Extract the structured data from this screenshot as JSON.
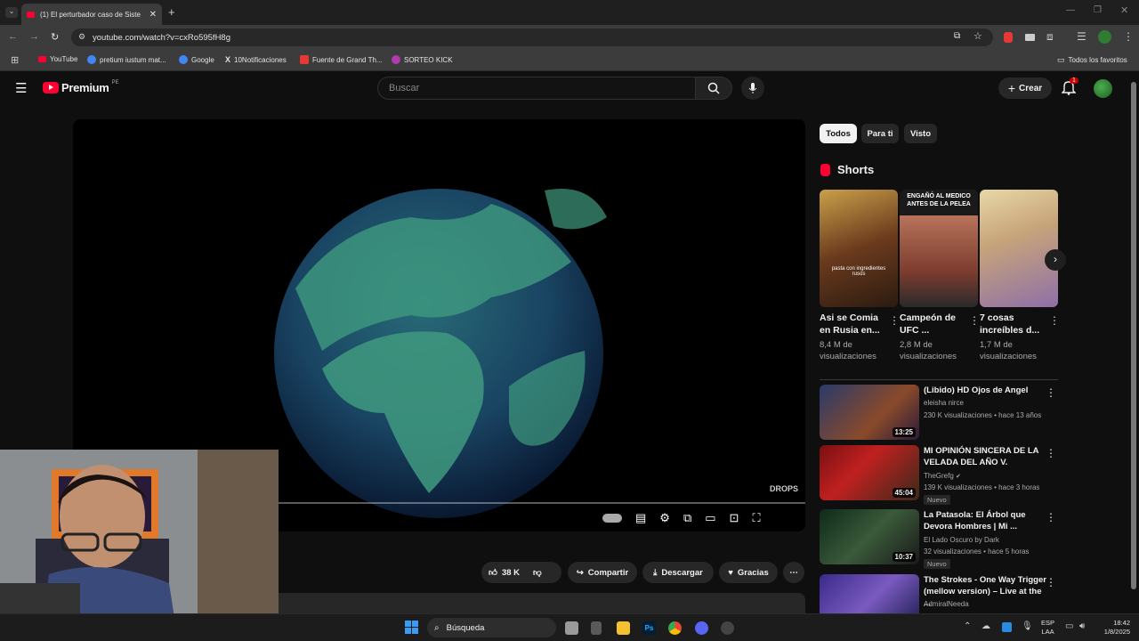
{
  "browser": {
    "tab_title": "(1) El perturbador caso de Siste",
    "url": "youtube.com/watch?v=cxRo595fH8g",
    "bookmarks": [
      "YouTube",
      "pretium iustum mat...",
      "Google",
      "10Notificaciones",
      "Fuente de Grand Th...",
      "SORTEO KICK"
    ],
    "all_bookmarks": "Todos los favoritos"
  },
  "youtube": {
    "logo_text": "Premium",
    "country": "PE",
    "search_placeholder": "Buscar",
    "create_label": "Crear",
    "notification_count": "1"
  },
  "chips": [
    "Todos",
    "Para ti",
    "Visto"
  ],
  "shorts_title": "Shorts",
  "shorts": [
    {
      "title": "Asi se Comia en Rusia en...",
      "views": "8,4 M de visualizaciones",
      "overlay": "pasta con ingredientes rusos"
    },
    {
      "title": "Campeón de UFC ...",
      "views": "2,8 M de visualizaciones",
      "overlay": "ENGAÑÓ AL MEDICO ANTES DE LA PELEA"
    },
    {
      "title": "7 cosas increíbles d...",
      "views": "1,7 M de visualizaciones",
      "overlay": ""
    }
  ],
  "recommendations": [
    {
      "title": "(Libido) HD Ojos de Angel",
      "channel": "eleisha nirce",
      "meta": "230 K visualizaciones • hace 13 años",
      "duration": "13:25",
      "badge": ""
    },
    {
      "title": "MI OPINIÓN SINCERA DE LA VELADA DEL AÑO V.",
      "channel": "TheGrefg",
      "meta": "139 K visualizaciones • hace 3 horas",
      "duration": "45:04",
      "badge": "Nuevo"
    },
    {
      "title": "La Patasola: El Árbol que Devora Hombres | Mi ...",
      "channel": "El Lado Oscuro by Dark",
      "meta": "32 visualizaciones • hace 5 horas",
      "duration": "10:37",
      "badge": "Nuevo"
    },
    {
      "title": "The Strokes - One Way Trigger (mellow version) – Live at the ...",
      "channel": "AdmiralNeeda",
      "meta": "",
      "duration": "",
      "badge": ""
    }
  ],
  "actions": {
    "likes": "38 K",
    "share": "Compartir",
    "download": "Descargar",
    "thanks": "Gracias"
  },
  "watermark": "DROPS",
  "taskbar": {
    "search": "Búsqueda",
    "lang1": "ESP",
    "lang2": "LAA",
    "time": "18:42",
    "date": "1/8/2025"
  }
}
